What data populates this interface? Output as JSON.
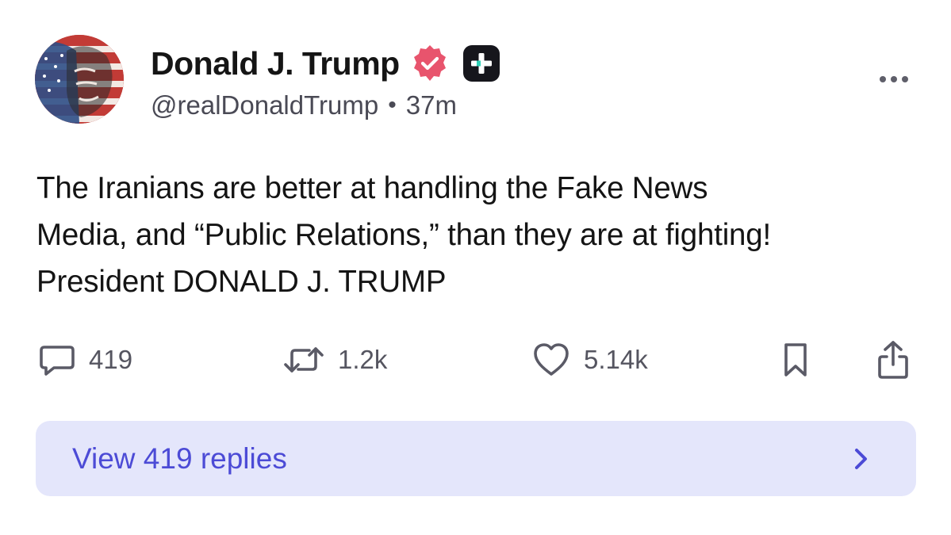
{
  "author": {
    "display_name": "Donald J. Trump",
    "handle": "@realDonaldTrump",
    "separator": "•",
    "time_ago": "37m",
    "verified_badge_icon": "verified-badge-icon",
    "plus_badge_icon": "plus-badge-icon",
    "badge_color": "#e8546d"
  },
  "post": {
    "lines": [
      "The Iranians are better at handling the Fake News",
      "Media, and “Public Relations,” than they are at fighting!",
      "President DONALD J. TRUMP"
    ]
  },
  "actions": {
    "reply": {
      "icon": "comment-icon",
      "count": "419"
    },
    "repost": {
      "icon": "repost-icon",
      "count": "1.2k"
    },
    "like": {
      "icon": "heart-icon",
      "count": "5.14k"
    },
    "bookmark": {
      "icon": "bookmark-icon"
    },
    "share": {
      "icon": "share-icon"
    }
  },
  "replies": {
    "label": "View 419 replies",
    "icon": "chevron-right-icon",
    "accent": "#4c4bd6",
    "background": "#e4e6fb"
  },
  "menu": {
    "icon": "more-icon"
  }
}
